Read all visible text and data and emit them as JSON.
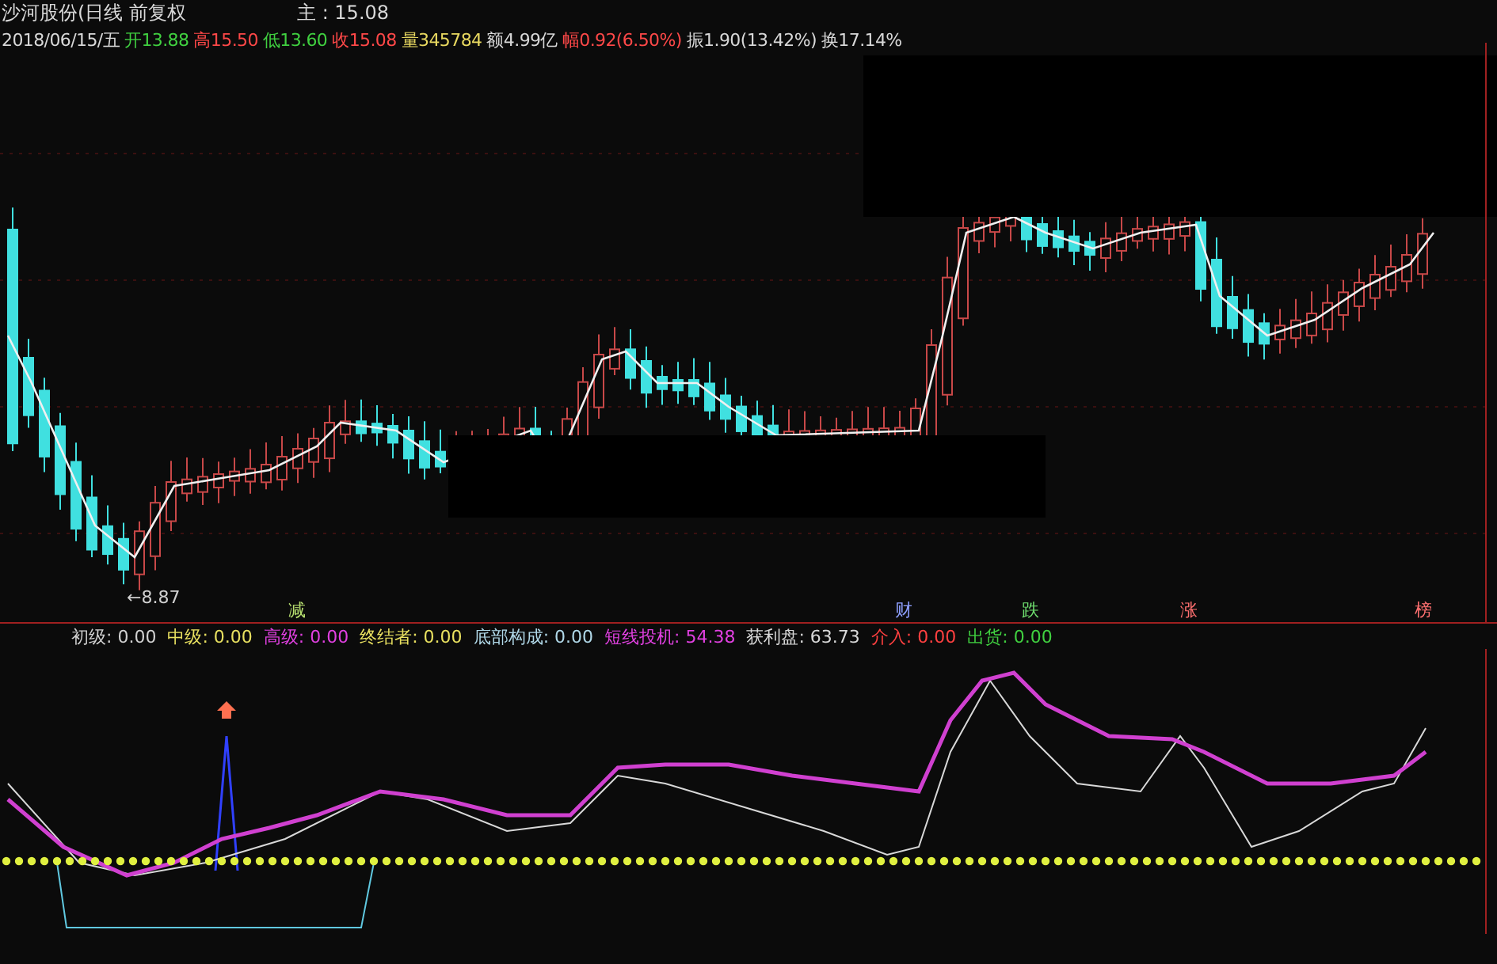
{
  "header": {
    "title": "沙河股份(日线 前复权",
    "price": "主 : 15.08"
  },
  "quote": [
    {
      "text": "2018/06/15/五",
      "color": "#d8d8d8"
    },
    {
      "text": "开13.88",
      "color": "#40d040"
    },
    {
      "text": "高15.50",
      "color": "#ff4848"
    },
    {
      "text": "低13.60",
      "color": "#40d040"
    },
    {
      "text": "收15.08",
      "color": "#ff4848"
    },
    {
      "text": "量345784",
      "color": "#e8d860"
    },
    {
      "text": "额4.99亿",
      "color": "#d8d8d8"
    },
    {
      "text": "幅0.92(6.50%)",
      "color": "#ff4848"
    },
    {
      "text": "振1.90(13.42%)",
      "color": "#d8d8d8"
    },
    {
      "text": "换17.14%",
      "color": "#d8d8d8"
    }
  ],
  "low_label": "←8.87",
  "events": [
    {
      "text": "减",
      "color": "#b8e070"
    },
    {
      "text": "财",
      "color": "#8fa0ff"
    },
    {
      "text": "跌",
      "color": "#70e070"
    },
    {
      "text": "涨",
      "color": "#ff7070"
    },
    {
      "text": "榜",
      "color": "#ff7070"
    }
  ],
  "indicators": [
    {
      "text": "初级: 0.00",
      "color": "#d0d0d0"
    },
    {
      "text": "中级: 0.00",
      "color": "#e8e060"
    },
    {
      "text": "高级: 0.00",
      "color": "#e040e0"
    },
    {
      "text": "终结者: 0.00",
      "color": "#e8e060"
    },
    {
      "text": "底部构成: 0.00",
      "color": "#b0d8e8"
    },
    {
      "text": "短线投机: 54.38",
      "color": "#e040e0"
    },
    {
      "text": "获利盘: 63.73",
      "color": "#d8d8d8"
    },
    {
      "text": "介入: 0.00",
      "color": "#ff4040"
    },
    {
      "text": "出货: 0.00",
      "color": "#40d040"
    }
  ]
}
